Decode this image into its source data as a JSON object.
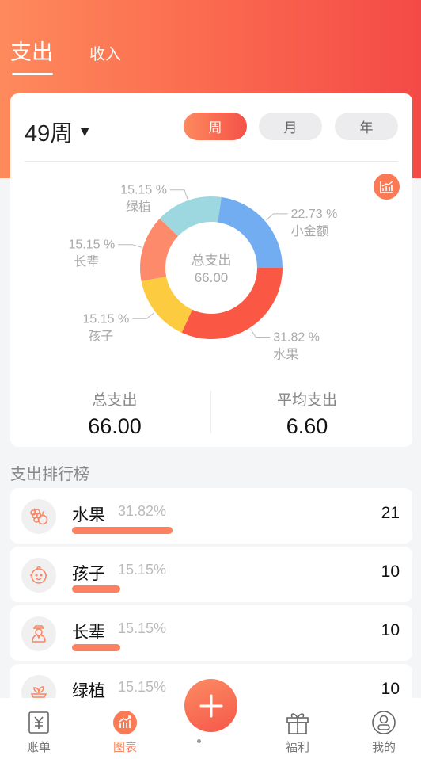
{
  "header": {
    "tabs": [
      {
        "label": "支出",
        "active": true
      },
      {
        "label": "收入",
        "active": false
      }
    ]
  },
  "summary_card": {
    "period_label": "49周",
    "period_caret": "▼",
    "segments": [
      {
        "label": "周",
        "active": true
      },
      {
        "label": "月",
        "active": false
      },
      {
        "label": "年",
        "active": false
      }
    ],
    "chart_toggle_icon": "chart-trend-icon",
    "stats": {
      "total_label": "总支出",
      "total_value": "66.00",
      "avg_label": "平均支出",
      "avg_value": "6.60"
    }
  },
  "chart_data": {
    "type": "pie",
    "variant": "donut",
    "center_title": "总支出",
    "center_value": "66.00",
    "slices": [
      {
        "label": "水果",
        "percent": 31.82,
        "display": "31.82 %",
        "color": "#fb5745"
      },
      {
        "label": "孩子",
        "percent": 15.15,
        "display": "15.15 %",
        "color": "#fdcb3f"
      },
      {
        "label": "长辈",
        "percent": 15.15,
        "display": "15.15 %",
        "color": "#fd8a6a"
      },
      {
        "label": "绿植",
        "percent": 15.15,
        "display": "15.15 %",
        "color": "#9dd8e0"
      },
      {
        "label": "小金额",
        "percent": 22.73,
        "display": "22.73 %",
        "color": "#73adf1"
      }
    ],
    "start_angle": "3 o'clock",
    "direction": "clockwise"
  },
  "ranking": {
    "title": "支出排行榜",
    "items": [
      {
        "name": "水果",
        "percent_label": "31.82%",
        "share": 0.3182,
        "amount": "21",
        "icon": "fruit-icon"
      },
      {
        "name": "孩子",
        "percent_label": "15.15%",
        "share": 0.1515,
        "amount": "10",
        "icon": "baby-face-icon"
      },
      {
        "name": "长辈",
        "percent_label": "15.15%",
        "share": 0.1515,
        "amount": "10",
        "icon": "elder-icon"
      },
      {
        "name": "绿植",
        "percent_label": "15.15%",
        "share": 0.1515,
        "amount": "10",
        "icon": "plant-icon"
      }
    ]
  },
  "tabbar": {
    "items": [
      {
        "label": "账单",
        "icon": "yen-bill-icon",
        "active": false
      },
      {
        "label": "图表",
        "icon": "chart-icon",
        "active": true
      },
      {
        "label": "福利",
        "icon": "gift-icon",
        "active": false
      },
      {
        "label": "我的",
        "icon": "user-icon",
        "active": false
      }
    ],
    "fab_icon": "plus-icon",
    "accent": "#f98562"
  }
}
